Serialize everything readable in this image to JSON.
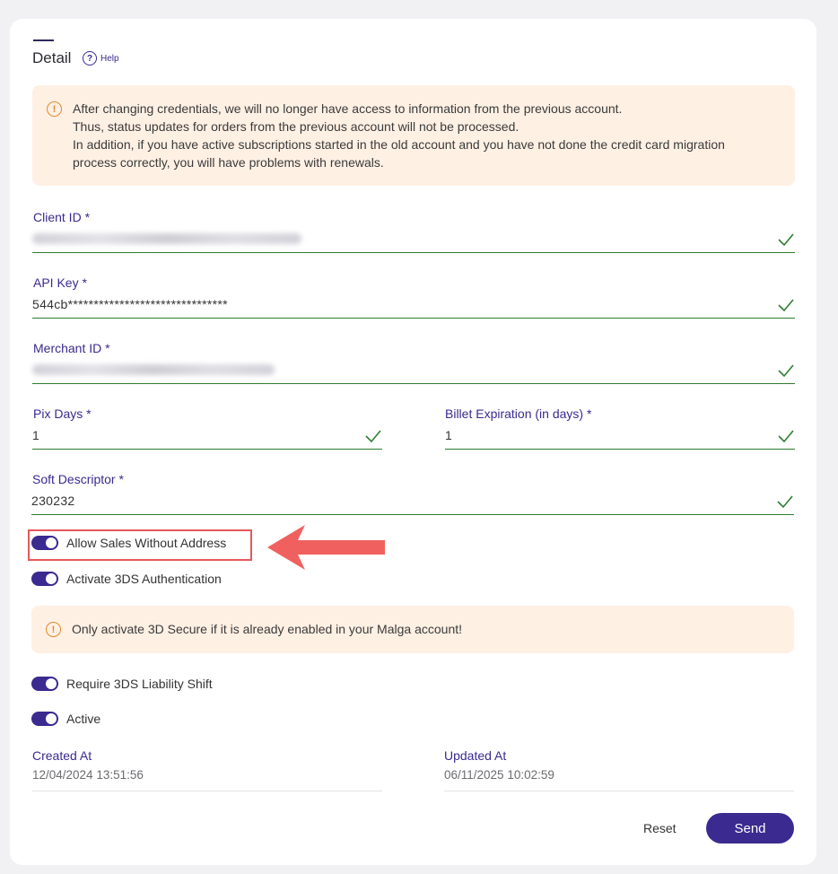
{
  "header": {
    "title": "Detail",
    "help_label": "Help"
  },
  "warning1": {
    "lines": [
      "After changing credentials, we will no longer have access to information from the previous account.",
      "Thus, status updates for orders from the previous account will not be processed.",
      "In addition, if you have active subscriptions started in the old account and you have not done the credit card migration",
      "process correctly, you will have problems with renewals."
    ]
  },
  "fields": {
    "client_id": {
      "label": "Client ID *",
      "value": ""
    },
    "api_key": {
      "label": "API Key *",
      "value": "544cb*******************************"
    },
    "merchant_id": {
      "label": "Merchant ID *",
      "value": ""
    },
    "pix_days": {
      "label": "Pix Days *",
      "value": "1"
    },
    "billet_expiration": {
      "label": "Billet Expiration (in days) *",
      "value": "1"
    },
    "soft_descriptor": {
      "label": "Soft Descriptor *",
      "value": "230232"
    }
  },
  "toggles": {
    "allow_sales_without_address": {
      "label": "Allow Sales Without Address",
      "on": true
    },
    "activate_3ds": {
      "label": "Activate 3DS Authentication",
      "on": true
    },
    "require_3ds_liability": {
      "label": "Require 3DS Liability Shift",
      "on": true
    },
    "active": {
      "label": "Active",
      "on": true
    }
  },
  "warning2": {
    "text": "Only activate 3D Secure if it is already enabled in your Malga account!"
  },
  "meta": {
    "created_label": "Created At",
    "created_value": "12/04/2024 13:51:56",
    "updated_label": "Updated At",
    "updated_value": "06/11/2025 10:02:59"
  },
  "actions": {
    "reset_label": "Reset",
    "send_label": "Send"
  },
  "colors": {
    "brand": "#3b2a8f",
    "valid": "#2e7d32",
    "warning_bg": "#fff0e4",
    "warning_icon": "#e08a2a",
    "annotation": "#e5585b"
  },
  "icons": {
    "help": "question-circle-icon",
    "warning": "exclamation-circle-icon",
    "valid": "check-icon",
    "annotation": "arrow-left-icon"
  }
}
